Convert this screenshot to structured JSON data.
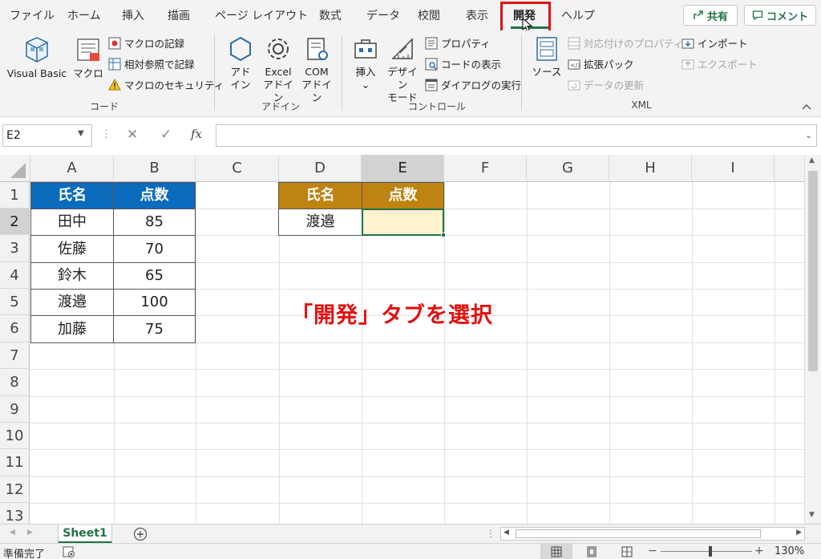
{
  "tabs": [
    "ファイル",
    "ホーム",
    "挿入",
    "描画",
    "ページ レイアウト",
    "数式",
    "データ",
    "校閲",
    "表示",
    "開発",
    "ヘルプ"
  ],
  "active_tab": "開発",
  "share_label": "共有",
  "comment_label": "コメント",
  "ribbon": {
    "code": {
      "group_label": "コード",
      "visual_basic": "Visual Basic",
      "macro": "マクロ",
      "record_macro": "マクロの記録",
      "relative_ref": "相対参照で記録",
      "macro_security": "マクロのセキュリティ"
    },
    "addins": {
      "group_label": "アドイン",
      "addin_1": "アド",
      "addin_2": "イン",
      "excel_1": "Excel",
      "excel_2": "アドイン",
      "com_1": "COM",
      "com_2": "アドイン"
    },
    "controls": {
      "group_label": "コントロール",
      "insert": "挿入",
      "design_1": "デザイン",
      "design_2": "モード",
      "properties": "プロパティ",
      "view_code": "コードの表示",
      "run_dialog": "ダイアログの実行"
    },
    "xml": {
      "group_label": "XML",
      "source": "ソース",
      "map_props": "対応付けのプロパティ",
      "expansion_packs": "拡張パック",
      "refresh_data": "データの更新",
      "import": "インポート",
      "export": "エクスポート"
    }
  },
  "name_box": "E2",
  "formula_icons": {
    "cancel": "✕",
    "enter": "✓",
    "fx": "fx"
  },
  "columns": [
    "A",
    "B",
    "C",
    "D",
    "E",
    "F",
    "G",
    "H",
    "I"
  ],
  "selected_column": "E",
  "rows": [
    "1",
    "2",
    "3",
    "4",
    "5",
    "6",
    "7",
    "8",
    "9",
    "10",
    "11",
    "12",
    "13"
  ],
  "selected_row": "2",
  "table1": {
    "headers": [
      "氏名",
      "点数"
    ],
    "rows": [
      [
        "田中",
        "85"
      ],
      [
        "佐藤",
        "70"
      ],
      [
        "鈴木",
        "65"
      ],
      [
        "渡邉",
        "100"
      ],
      [
        "加藤",
        "75"
      ]
    ]
  },
  "table2": {
    "headers": [
      "氏名",
      "点数"
    ],
    "row": [
      "渡邉",
      ""
    ]
  },
  "caption": "「開発」タブを選択",
  "sheet_tab": "Sheet1",
  "status": "準備完了",
  "zoom": "130%",
  "colors": {
    "accent": "#217346",
    "header_blue": "#0b6bbd",
    "header_gold": "#bf8311",
    "highlight": "#e01010",
    "selected_cell_fill": "#fff2cc"
  }
}
